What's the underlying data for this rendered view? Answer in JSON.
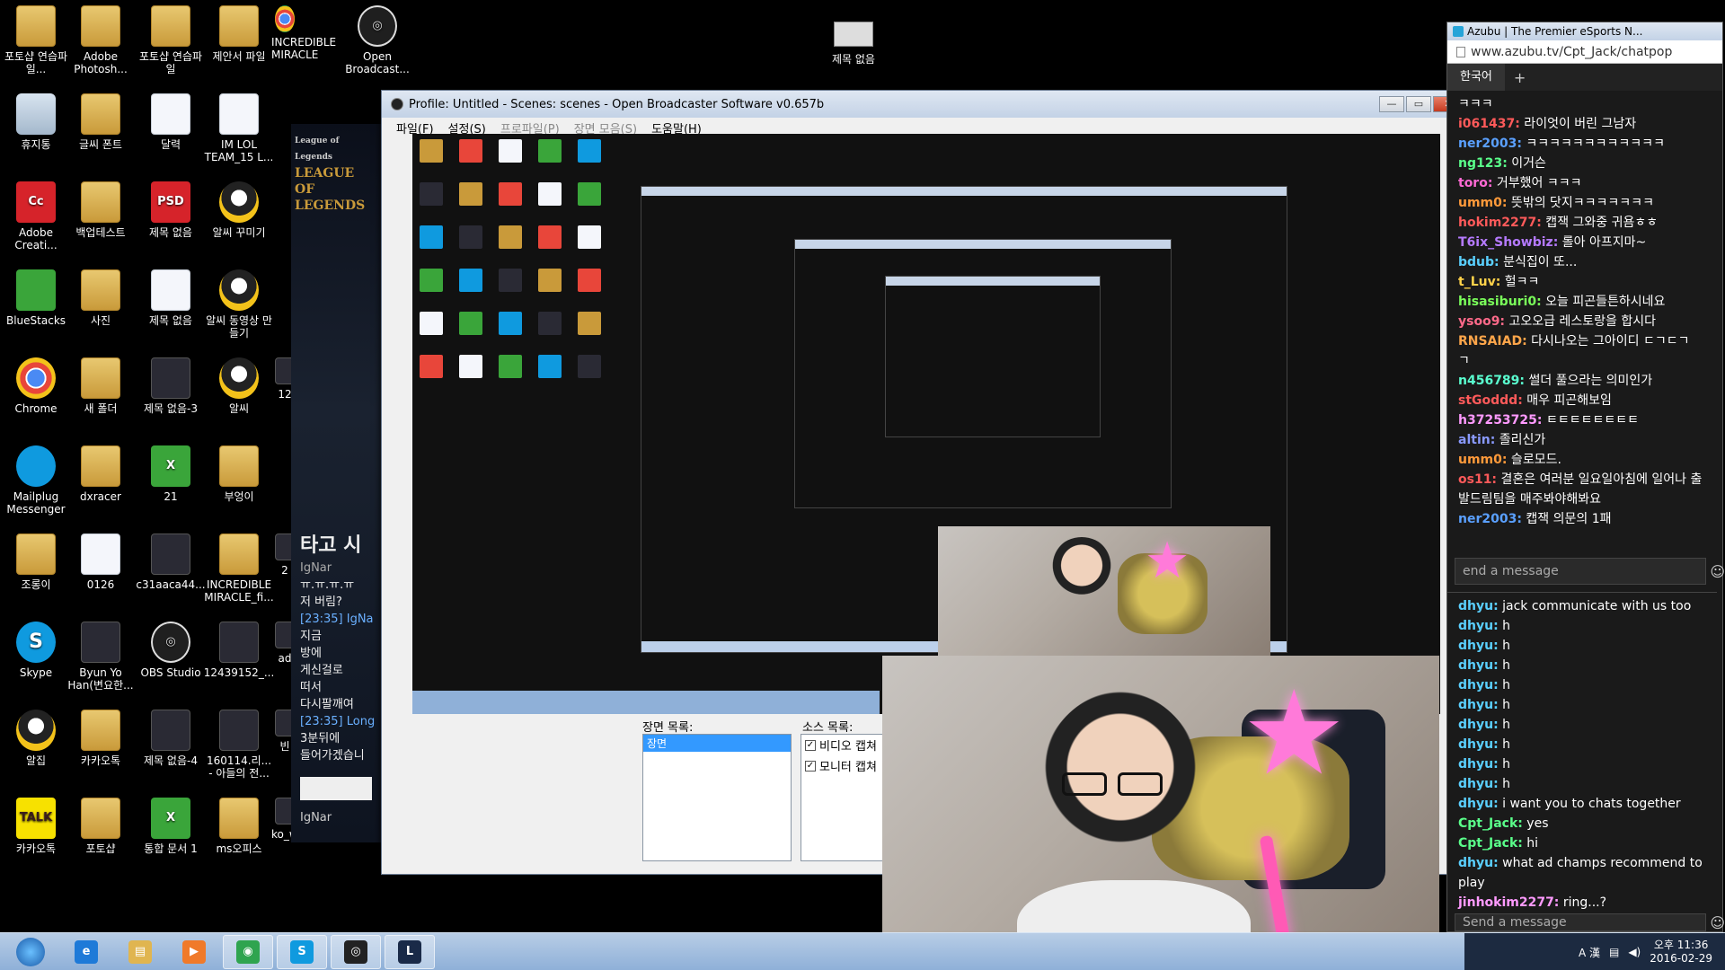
{
  "desktop_icons": [
    {
      "label": "포토샵 연습파일...",
      "icon": "folder-icon"
    },
    {
      "label": "Adobe Photosh...",
      "icon": "folder-icon"
    },
    {
      "label": "포토샵 연습파일",
      "icon": "folder-icon"
    },
    {
      "label": "제안서 파일",
      "icon": "folder-icon"
    },
    {
      "label": "INCREDIBLE MIRACLE",
      "icon": "chrome-icon"
    },
    {
      "label": "Open Broadcast...",
      "icon": "obs-icon"
    },
    {
      "label": "휴지통",
      "icon": "recycle-bin-icon"
    },
    {
      "label": "글씨 폰트",
      "icon": "folder-icon"
    },
    {
      "label": "달력",
      "icon": "document-icon"
    },
    {
      "label": "IM LOL TEAM_15 L...",
      "icon": "document-icon"
    },
    {
      "label": "Adobe Creati...",
      "icon": "adobe-icon"
    },
    {
      "label": "백업테스트",
      "icon": "folder-icon"
    },
    {
      "label": "제목 없음",
      "icon": "psd-icon"
    },
    {
      "label": "알씨 꾸미기",
      "icon": "alsee-icon"
    },
    {
      "label": "BlueStacks",
      "icon": "bluestacks-icon"
    },
    {
      "label": "사진",
      "icon": "folder-icon"
    },
    {
      "label": "제목 없음",
      "icon": "document-icon"
    },
    {
      "label": "알씨 동영상 만들기",
      "icon": "alsee-icon"
    },
    {
      "label": "Chrome",
      "icon": "chrome-icon"
    },
    {
      "label": "새 폴더",
      "icon": "folder-icon"
    },
    {
      "label": "제목 없음-3",
      "icon": "image-icon"
    },
    {
      "label": "알씨",
      "icon": "alsee-icon"
    },
    {
      "label": "Mailplug Messenger",
      "icon": "mailplug-icon"
    },
    {
      "label": "dxracer",
      "icon": "folder-icon"
    },
    {
      "label": "21",
      "icon": "excel-icon"
    },
    {
      "label": "부엉이",
      "icon": "folder-icon"
    },
    {
      "label": "조롱이",
      "icon": "folder-icon"
    },
    {
      "label": "0126",
      "icon": "document-icon"
    },
    {
      "label": "c31aaca44...",
      "icon": "image-icon"
    },
    {
      "label": "INCREDIBLE MIRACLE_fi...",
      "icon": "folder-icon"
    },
    {
      "label": "Skype",
      "icon": "skype-icon"
    },
    {
      "label": "Byun Yo Han(변요한...",
      "icon": "image-icon"
    },
    {
      "label": "OBS Studio",
      "icon": "obs-icon"
    },
    {
      "label": "12439152_...",
      "icon": "image-icon"
    },
    {
      "label": "알집",
      "icon": "alzip-icon"
    },
    {
      "label": "카카오톡",
      "icon": "folder-icon"
    },
    {
      "label": "제목 없음-4",
      "icon": "image-icon"
    },
    {
      "label": "160114.리... - 아들의 전...",
      "icon": "image-icon"
    },
    {
      "label": "카카오톡",
      "icon": "kakaotalk-icon"
    },
    {
      "label": "포토샵",
      "icon": "folder-icon"
    },
    {
      "label": "통합 문서 1",
      "icon": "excel-icon"
    },
    {
      "label": "ms오피스",
      "icon": "folder-icon"
    },
    {
      "label": "ko_window...",
      "icon": "image-icon"
    },
    {
      "label": "12",
      "icon": "image-icon"
    },
    {
      "label": "ad",
      "icon": "image-icon"
    },
    {
      "label": "2",
      "icon": "image-icon"
    },
    {
      "label": "빈",
      "icon": "image-icon"
    }
  ],
  "top_center_icon": {
    "label": "제목 없음"
  },
  "league": {
    "logo_small": "League of Legends",
    "logo_big": "LEAGUE OF LEGENDS",
    "panel_title": "타고 시",
    "chat_user": "IgNar",
    "chat_lines": [
      "ㅠ.ㅠ.ㅠ.ㅠ",
      "저 버림?",
      "[23:35] IgNa",
      "지금",
      "방에",
      "게신걸로",
      "떠서",
      "다시팔깨여",
      "[23:35] Long",
      "3분뒤에",
      "들어가겠습니"
    ],
    "footer_user": "IgNar"
  },
  "obs": {
    "title": "Profile: Untitled - Scenes: scenes - Open Broadcaster Software v0.657b",
    "menu": [
      "파일(F)",
      "설정(S)",
      "프로파일(P)",
      "장면 모음(S)",
      "도움말(H)"
    ],
    "scenes_label": "장면 목록:",
    "scene_selected": "장면",
    "sources_label": "소스 목록:",
    "sources": [
      {
        "label": "비디오 캡쳐",
        "checked": true
      },
      {
        "label": "모니터 캡쳐",
        "checked": true
      }
    ],
    "win_buttons": {
      "min": "—",
      "max": "▭",
      "close": "✕"
    }
  },
  "chat": {
    "window_title": "Azubu | The Premier eSports N...",
    "url": "www.azubu.tv/Cpt_Jack/chatpop",
    "tab": "한국어",
    "tab_add": "+",
    "messages_top": [
      {
        "user": "",
        "text": "ㅋㅋㅋ",
        "color": "#ffffff"
      },
      {
        "user": "i061437:",
        "text": " 라이엇이 버린 그남자",
        "color": "#ff5a5a"
      },
      {
        "user": "ner2003:",
        "text": " ㅋㅋㅋㅋㅋㅋㅋㅋㅋㅋㅋㅋ",
        "color": "#5aa0ff"
      },
      {
        "user": "ng123:",
        "text": " 이거슨",
        "color": "#5aff8a"
      },
      {
        "user": "toro:",
        "text": " 거부했어 ㅋㅋㅋ",
        "color": "#ff6ad5"
      },
      {
        "user": "umm0:",
        "text": " 뜻밖의 닷지ㅋㅋㅋㅋㅋㅋㅋ",
        "color": "#ff9a3a"
      },
      {
        "user": "hokim2277:",
        "text": " 캡잭 그와중 귀욤ㅎㅎ",
        "color": "#ff5a5a"
      },
      {
        "user": "T6ix_Showbiz:",
        "text": " 롤아 아프지마~",
        "color": "#b57aff"
      },
      {
        "user": "bdub:",
        "text": " 분식집이 또...",
        "color": "#5ad0ff"
      },
      {
        "user": "t_Luv:",
        "text": " 헐ㅋㅋ",
        "color": "#ffd24a"
      },
      {
        "user": "hisasiburi0:",
        "text": " 오늘 피곤들튼하시네요",
        "color": "#7aff5a"
      },
      {
        "user": "ysoo9:",
        "text": " 고오오급 레스토랑을 합시다",
        "color": "#ff6a8a"
      },
      {
        "user": "RNSAIAD:",
        "text": " 다시나오는 그아이디 ㄷㄱㄷㄱ",
        "color": "#ffa64a"
      },
      {
        "user": "",
        "text": "ㄱ",
        "color": "#ffffff"
      },
      {
        "user": "n456789:",
        "text": " 썰더 풀으라는 의미인가",
        "color": "#5affd0"
      },
      {
        "user": "stGoddd:",
        "text": " 매우 피곤해보임",
        "color": "#ff5a5a"
      },
      {
        "user": "h37253725:",
        "text": " ㅌㅌㅌㅌㅌㅌㅌㅌ",
        "color": "#ff9aff"
      },
      {
        "user": "altin:",
        "text": " 졸리신가",
        "color": "#8a9aff"
      },
      {
        "user": "umm0:",
        "text": " 슬로모드.",
        "color": "#ff9a3a"
      },
      {
        "user": "os11:",
        "text": " 결혼은 여러분 일요일아침에 일어나 출발드림팀을 매주봐야해봐요",
        "color": "#ff5a5a"
      },
      {
        "user": "ner2003:",
        "text": " 캡잭 의문의 1패",
        "color": "#5aa0ff"
      }
    ],
    "input_placeholder": "end a message",
    "messages_bottom": [
      {
        "user": "dhyu:",
        "text": " jack communicate with us too",
        "color": "#5ad0ff"
      },
      {
        "user": "dhyu:",
        "text": " h",
        "color": "#5ad0ff"
      },
      {
        "user": "dhyu:",
        "text": " h",
        "color": "#5ad0ff"
      },
      {
        "user": "dhyu:",
        "text": " h",
        "color": "#5ad0ff"
      },
      {
        "user": "dhyu:",
        "text": " h",
        "color": "#5ad0ff"
      },
      {
        "user": "dhyu:",
        "text": " h",
        "color": "#5ad0ff"
      },
      {
        "user": "dhyu:",
        "text": " h",
        "color": "#5ad0ff"
      },
      {
        "user": "dhyu:",
        "text": " h",
        "color": "#5ad0ff"
      },
      {
        "user": "dhyu:",
        "text": " h",
        "color": "#5ad0ff"
      },
      {
        "user": "dhyu:",
        "text": " h",
        "color": "#5ad0ff"
      },
      {
        "user": "dhyu:",
        "text": " i want you to chats together",
        "color": "#5ad0ff"
      },
      {
        "user": "Cpt_Jack:",
        "text": " yes",
        "color": "#5aff8a"
      },
      {
        "user": "Cpt_Jack:",
        "text": " hi",
        "color": "#5aff8a"
      },
      {
        "user": "dhyu:",
        "text": " what ad champs recommend to play",
        "color": "#5ad0ff"
      },
      {
        "user": "jinhokim2277:",
        "text": " ring...?",
        "color": "#ff9aff"
      }
    ],
    "input2_placeholder": "Send a message",
    "emoticon_glyph": "☺",
    "settings_glyph": "⚙"
  },
  "taskbar": {
    "apps": [
      {
        "name": "ie-icon",
        "glyph": "e",
        "bg": "#1e7ad8"
      },
      {
        "name": "explorer-icon",
        "glyph": "▤",
        "bg": "#e0b550"
      },
      {
        "name": "media-player-icon",
        "glyph": "▶",
        "bg": "#f07a2a"
      },
      {
        "name": "chrome-icon",
        "glyph": "◉",
        "bg": "#2fa44f"
      },
      {
        "name": "skype-icon",
        "glyph": "S",
        "bg": "#0f9adf"
      },
      {
        "name": "obs-icon",
        "glyph": "◎",
        "bg": "#222"
      },
      {
        "name": "lol-icon",
        "glyph": "L",
        "bg": "#1a2a48"
      }
    ],
    "tray_lang": "A 漢",
    "time": "오후 11:36",
    "date": "2016-02-29"
  }
}
